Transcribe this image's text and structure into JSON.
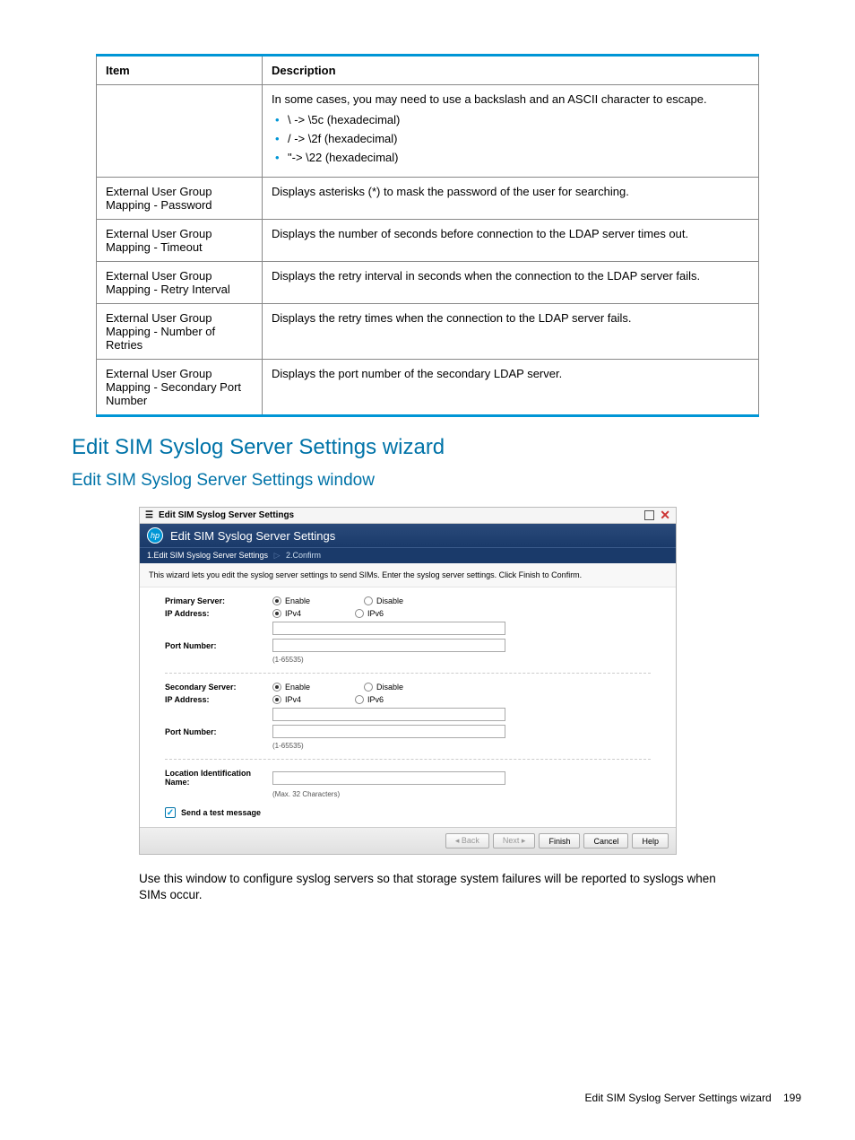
{
  "table": {
    "headers": {
      "item": "Item",
      "description": "Description"
    },
    "rows": [
      {
        "item": "",
        "intro": "In some cases, you may need to use a backslash and an ASCII character to escape.",
        "bullets": [
          "\\ -> \\5c (hexadecimal)",
          "/ -> \\2f (hexadecimal)",
          "\"-> \\22 (hexadecimal)"
        ]
      },
      {
        "item": "External User Group Mapping - Password",
        "desc": "Displays asterisks (*) to mask the password of the user for searching."
      },
      {
        "item": "External User Group Mapping - Timeout",
        "desc": "Displays the number of seconds before connection to the LDAP server times out."
      },
      {
        "item": "External User Group Mapping - Retry Interval",
        "desc": "Displays the retry interval in seconds when the connection to the LDAP server fails."
      },
      {
        "item": "External User Group Mapping - Number of Retries",
        "desc": "Displays the retry times when the connection to the LDAP server fails."
      },
      {
        "item": "External User Group Mapping - Secondary Port Number",
        "desc": "Displays the port number of the secondary LDAP server."
      }
    ]
  },
  "heading1": "Edit SIM Syslog Server Settings wizard",
  "heading2": "Edit SIM Syslog Server Settings window",
  "wizard": {
    "titlebar": "Edit SIM Syslog Server Settings",
    "header": "Edit SIM Syslog Server Settings",
    "step1": "1.Edit SIM Syslog Server Settings",
    "step2": "2.Confirm",
    "desc": "This wizard lets you edit the syslog server settings to send SIMs. Enter the syslog server settings. Click Finish to Confirm.",
    "labels": {
      "primary_server": "Primary Server:",
      "ip_address": "IP Address:",
      "port_number": "Port Number:",
      "secondary_server": "Secondary Server:",
      "location": "Location Identification Name:",
      "enable": "Enable",
      "disable": "Disable",
      "ipv4": "IPv4",
      "ipv6": "IPv6",
      "port_hint": "(1-65535)",
      "loc_hint": "(Max. 32 Characters)",
      "send_test": "Send a test message"
    },
    "buttons": {
      "back": "◂ Back",
      "next": "Next ▸",
      "finish": "Finish",
      "cancel": "Cancel",
      "help": "Help"
    }
  },
  "body_text": "Use this window to configure syslog servers so that storage system failures will be reported to syslogs when SIMs occur.",
  "footer": {
    "title": "Edit SIM Syslog Server Settings wizard",
    "page": "199"
  }
}
